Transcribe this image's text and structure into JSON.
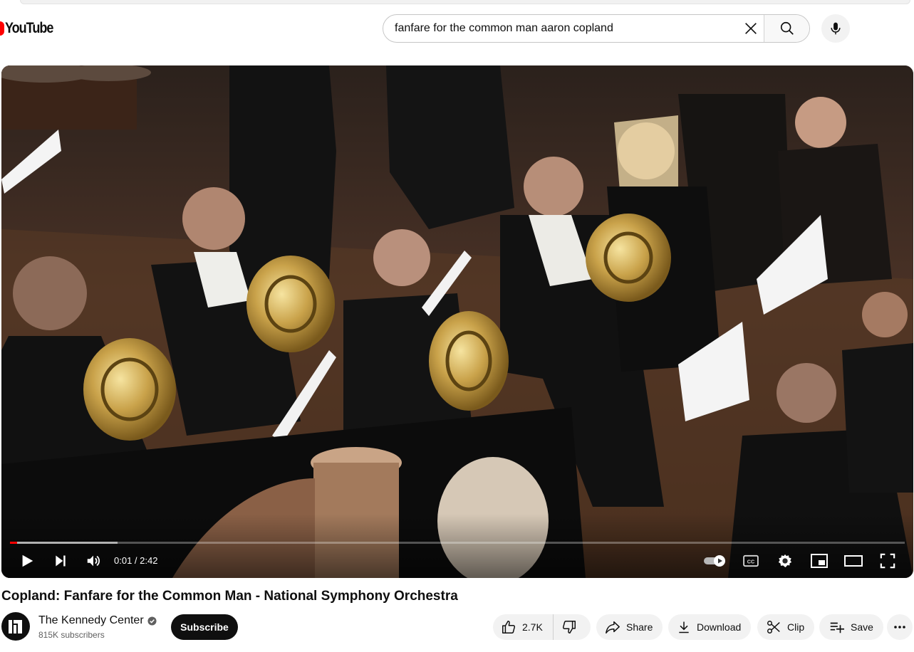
{
  "header": {
    "logo_text": "YouTube",
    "search_value": "fanfare for the common man aaron copland",
    "icons": [
      "youtube-logo-icon",
      "clear-icon",
      "search-icon",
      "microphone-icon"
    ]
  },
  "player": {
    "time_display": "0:01 / 2:42",
    "progress_fraction": 0.006,
    "buffered_fraction": 0.12,
    "icons": [
      "play-icon",
      "next-icon",
      "volume-icon",
      "autoplay-toggle-icon",
      "subtitles-icon",
      "settings-icon",
      "miniplayer-icon",
      "theater-mode-icon",
      "fullscreen-icon"
    ],
    "accent_color": "#ff0000"
  },
  "video": {
    "title": "Copland: Fanfare for the Common Man - National Symphony Orchestra"
  },
  "channel": {
    "name": "The Kennedy Center",
    "subscribers": "815K subscribers",
    "verified": true,
    "subscribe_label": "Subscribe"
  },
  "actions": {
    "like_count": "2.7K",
    "share_label": "Share",
    "download_label": "Download",
    "clip_label": "Clip",
    "save_label": "Save",
    "icons": [
      "thumbs-up-icon",
      "thumbs-down-icon",
      "share-icon",
      "download-icon",
      "scissors-icon",
      "playlist-add-icon",
      "more-icon"
    ]
  }
}
